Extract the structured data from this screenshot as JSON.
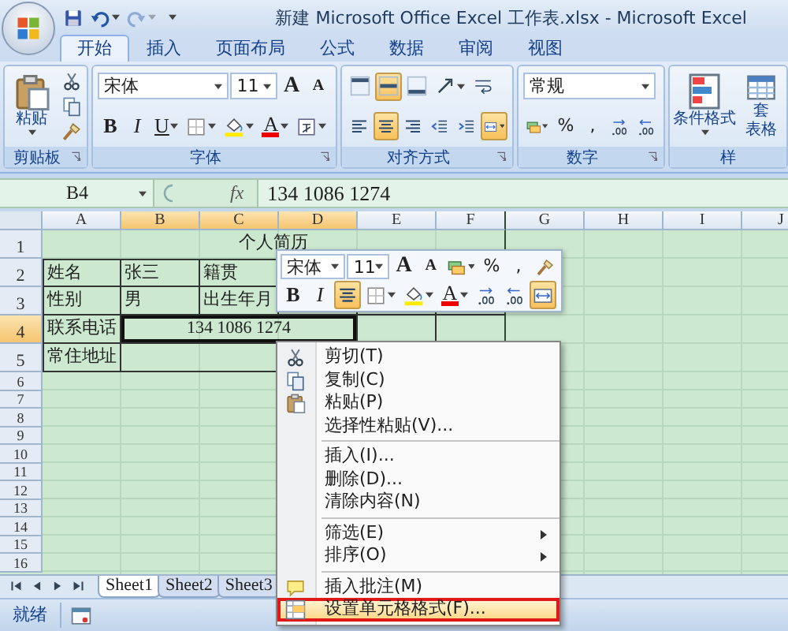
{
  "title_bar": {
    "title": "新建 Microsoft Office Excel 工作表.xlsx - Microsoft Excel",
    "quick_access": [
      {
        "kind": "save",
        "disabled": false
      },
      {
        "kind": "undo",
        "dropdown": true,
        "disabled": false
      },
      {
        "kind": "redo",
        "dropdown": true,
        "disabled": true
      },
      {
        "kind": "customize",
        "dropdown": true,
        "disabled": false
      }
    ]
  },
  "ribbon_tabs": [
    {
      "label": "开始",
      "selected": true
    },
    {
      "label": "插入",
      "selected": false
    },
    {
      "label": "页面布局",
      "selected": false
    },
    {
      "label": "公式",
      "selected": false
    },
    {
      "label": "数据",
      "selected": false
    },
    {
      "label": "审阅",
      "selected": false
    },
    {
      "label": "视图",
      "selected": false
    }
  ],
  "ribbon": {
    "clipboard": {
      "label": "剪贴板",
      "launcher": true,
      "paste": "粘贴",
      "tools": [
        {
          "kind": "cut"
        },
        {
          "kind": "copy"
        },
        {
          "kind": "painter"
        }
      ]
    },
    "font": {
      "label": "字体",
      "launcher": true,
      "font_name": "宋体",
      "font_size": "11",
      "row1": [
        {
          "kind": "grow",
          "text": "A"
        },
        {
          "kind": "shrink",
          "text": "A"
        }
      ],
      "row2": [
        {
          "kind": "bold",
          "text": "B"
        },
        {
          "kind": "italic",
          "text": "I"
        },
        {
          "kind": "underline",
          "text": "U",
          "dropdown": true
        },
        {
          "kind": "border",
          "dropdown": true
        },
        {
          "kind": "fill",
          "dropdown": true
        },
        {
          "kind": "fontcolor",
          "text": "A",
          "dropdown": true
        },
        {
          "kind": "phonetic",
          "dropdown": true
        }
      ]
    },
    "alignment": {
      "label": "对齐方式",
      "launcher": true,
      "row1": [
        {
          "kind": "top",
          "active": false
        },
        {
          "kind": "middle",
          "active": true
        },
        {
          "kind": "bottom",
          "active": false
        },
        {
          "kind": "orientation",
          "dropdown": true,
          "active": false
        },
        {
          "kind": "wrap",
          "active": false
        }
      ],
      "row2": [
        {
          "kind": "left",
          "active": false
        },
        {
          "kind": "center",
          "active": true
        },
        {
          "kind": "right",
          "active": false
        },
        {
          "kind": "outdent",
          "active": false
        },
        {
          "kind": "indent",
          "active": false
        },
        {
          "kind": "merge",
          "dropdown": true,
          "active": true
        }
      ]
    },
    "number": {
      "label": "数字",
      "launcher": true,
      "format": "常规",
      "row2": [
        {
          "kind": "currency",
          "dropdown": true
        },
        {
          "kind": "glyph",
          "text": "%"
        },
        {
          "kind": "glyph",
          "text": ","
        },
        {
          "kind": "moredec"
        },
        {
          "kind": "lessdec"
        }
      ]
    },
    "styles": {
      "label": "样",
      "buttons": [
        {
          "kind": "conditional",
          "lines": [
            "条件格式"
          ],
          "dropdown": true
        },
        {
          "kind": "table",
          "lines": [
            "套",
            "表格"
          ]
        }
      ]
    }
  },
  "formula_bar": {
    "name_box": "B4",
    "function_label": "fx",
    "formula": "134 1086 1274"
  },
  "sheet": {
    "columns": [
      {
        "label": "A",
        "selected": false
      },
      {
        "label": "B",
        "selected": true
      },
      {
        "label": "C",
        "selected": true
      },
      {
        "label": "D",
        "selected": true
      },
      {
        "label": "E",
        "selected": false
      },
      {
        "label": "F",
        "selected": false
      },
      {
        "label": "G",
        "selected": false
      },
      {
        "label": "H",
        "selected": false
      },
      {
        "label": "I",
        "selected": false
      },
      {
        "label": "J",
        "selected": false
      }
    ],
    "rows": [
      {
        "header": "1",
        "selected": false,
        "kind": "title",
        "cells": [
          {
            "text": "个人简历",
            "selected": false
          }
        ]
      },
      {
        "header": "2",
        "selected": false,
        "kind": "table",
        "cells": [
          {
            "text": "姓名",
            "merged": false,
            "selected": false
          },
          {
            "text": "张三",
            "merged": false,
            "selected": false
          },
          {
            "text": "籍贯",
            "merged": false,
            "selected": false
          }
        ]
      },
      {
        "header": "3",
        "selected": false,
        "kind": "table",
        "cells": [
          {
            "text": "性别",
            "merged": false,
            "selected": false
          },
          {
            "text": "男",
            "merged": false,
            "selected": false
          },
          {
            "text": "出生年月",
            "merged": false,
            "selected": false
          }
        ]
      },
      {
        "header": "4",
        "selected": true,
        "kind": "table",
        "cells": [
          {
            "text": "联系电话",
            "merged": false,
            "selected": false
          },
          {
            "text": "134 1086 1274",
            "merged": true,
            "selected": true
          }
        ]
      },
      {
        "header": "5",
        "selected": false,
        "kind": "table",
        "cells": [
          {
            "text": "常住地址",
            "merged": false,
            "selected": false
          },
          {
            "merged": true
          }
        ]
      },
      {
        "header": "6",
        "selected": false,
        "kind": "empty"
      },
      {
        "header": "7",
        "selected": false,
        "kind": "empty"
      },
      {
        "header": "8",
        "selected": false,
        "kind": "empty"
      },
      {
        "header": "9",
        "selected": false,
        "kind": "empty"
      },
      {
        "header": "10",
        "selected": false,
        "kind": "empty"
      },
      {
        "header": "11",
        "selected": false,
        "kind": "empty"
      },
      {
        "header": "12",
        "selected": false,
        "kind": "empty"
      },
      {
        "header": "13",
        "selected": false,
        "kind": "empty"
      },
      {
        "header": "14",
        "selected": false,
        "kind": "empty"
      },
      {
        "header": "15",
        "selected": false,
        "kind": "empty"
      },
      {
        "header": "16",
        "selected": false,
        "kind": "empty"
      }
    ]
  },
  "sheet_tabs": [
    {
      "label": "Sheet1",
      "selected": true
    },
    {
      "label": "Sheet2",
      "selected": false
    },
    {
      "label": "Sheet3",
      "selected": false
    }
  ],
  "status_bar": {
    "text": "就绪"
  },
  "mini_toolbar": {
    "font_name": "宋体",
    "font_size": "11",
    "row1": [
      {
        "kind": "grow",
        "text": "A"
      },
      {
        "kind": "shrink",
        "text": "A"
      },
      {
        "kind": "currency",
        "dropdown": true
      },
      {
        "kind": "glyph",
        "text": "%"
      },
      {
        "kind": "glyph",
        "text": ","
      },
      {
        "kind": "painter"
      }
    ],
    "row2": [
      {
        "kind": "bold",
        "text": "B",
        "active": false
      },
      {
        "kind": "italic",
        "text": "I",
        "active": false
      },
      {
        "kind": "center",
        "active": true
      },
      {
        "kind": "border",
        "dropdown": true,
        "active": false
      },
      {
        "kind": "fill",
        "dropdown": true,
        "active": false
      },
      {
        "kind": "fontcolor",
        "text": "A",
        "dropdown": true,
        "active": false
      },
      {
        "kind": "moredec",
        "active": false
      },
      {
        "kind": "lessdec",
        "active": false
      },
      {
        "kind": "merge",
        "active": true
      }
    ]
  },
  "context_menu": {
    "items": [
      {
        "kind": "cut",
        "label": "剪切(T)",
        "highlighted": false
      },
      {
        "kind": "copy",
        "label": "复制(C)",
        "highlighted": false
      },
      {
        "kind": "paste",
        "label": "粘贴(P)",
        "highlighted": false
      },
      {
        "kind": "plain",
        "label": "选择性粘贴(V)...",
        "highlighted": false
      },
      {
        "kind": "separator"
      },
      {
        "kind": "plain",
        "label": "插入(I)...",
        "highlighted": false
      },
      {
        "kind": "plain",
        "label": "删除(D)...",
        "highlighted": false
      },
      {
        "kind": "plain",
        "label": "清除内容(N)",
        "highlighted": false
      },
      {
        "kind": "separator"
      },
      {
        "kind": "plain",
        "label": "筛选(E)",
        "submenu": true,
        "highlighted": false
      },
      {
        "kind": "plain",
        "label": "排序(O)",
        "submenu": true,
        "highlighted": false
      },
      {
        "kind": "separator"
      },
      {
        "kind": "comment",
        "label": "插入批注(M)",
        "highlighted": false
      },
      {
        "kind": "format",
        "label": "设置单元格格式(F)...",
        "highlighted": true
      }
    ]
  }
}
